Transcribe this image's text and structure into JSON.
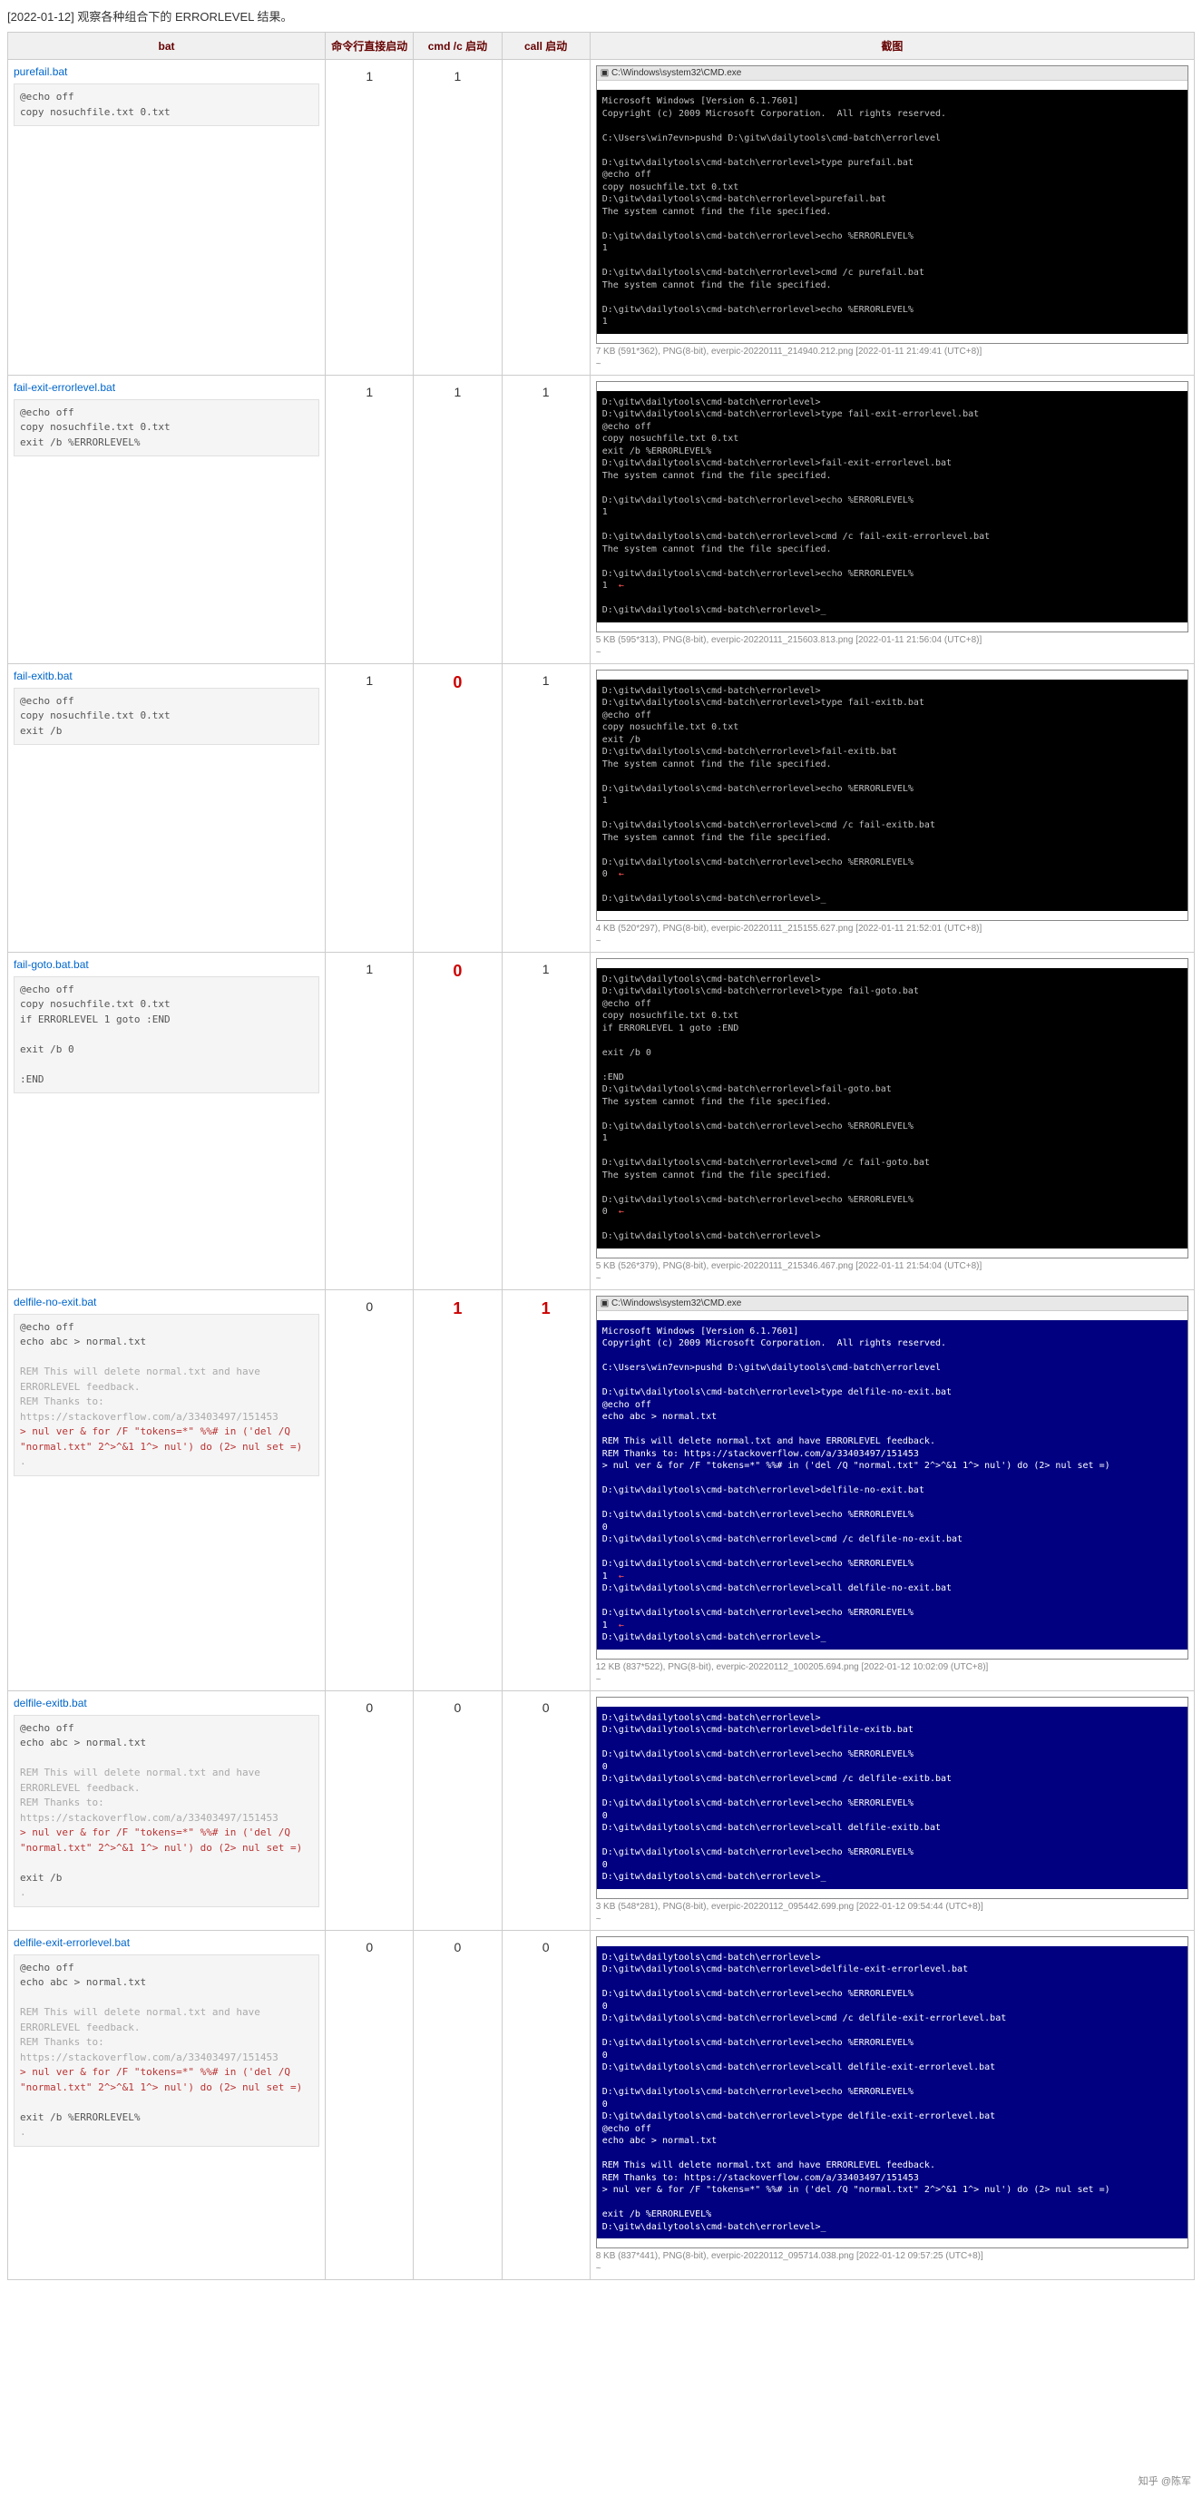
{
  "title": "[2022-01-12] 观察各种组合下的 ERRORLEVEL 结果。",
  "headers": {
    "bat": "bat",
    "direct": "命令行直接启动",
    "cmdc": "cmd /c 启动",
    "call": "call 启动",
    "shot": "截图"
  },
  "rows": [
    {
      "name": "purefail.bat",
      "code": "@echo off\ncopy nosuchfile.txt 0.txt",
      "direct": "1",
      "cmdc": "1",
      "call": "",
      "title": "C:\\Windows\\system32\\CMD.exe",
      "theme": "black",
      "shot": "Microsoft Windows [Version 6.1.7601]\nCopyright (c) 2009 Microsoft Corporation.  All rights reserved.\n\nC:\\Users\\win7evn>pushd D:\\gitw\\dailytools\\cmd-batch\\errorlevel\n\nD:\\gitw\\dailytools\\cmd-batch\\errorlevel>type purefail.bat\n@echo off\ncopy nosuchfile.txt 0.txt\nD:\\gitw\\dailytools\\cmd-batch\\errorlevel>purefail.bat\nThe system cannot find the file specified.\n\nD:\\gitw\\dailytools\\cmd-batch\\errorlevel>echo %ERRORLEVEL%\n1\n\nD:\\gitw\\dailytools\\cmd-batch\\errorlevel>cmd /c purefail.bat\nThe system cannot find the file specified.\n\nD:\\gitw\\dailytools\\cmd-batch\\errorlevel>echo %ERRORLEVEL%\n1",
      "cap": "7 KB (591*362), PNG(8-bit), everpic-20220111_214940.212.png [2022-01-11 21:49:41 (UTC+8)]"
    },
    {
      "name": "fail-exit-errorlevel.bat",
      "code": "@echo off\ncopy nosuchfile.txt 0.txt\nexit /b %ERRORLEVEL%",
      "direct": "1",
      "cmdc": "1",
      "call": "1",
      "theme": "black",
      "shot": "D:\\gitw\\dailytools\\cmd-batch\\errorlevel>\nD:\\gitw\\dailytools\\cmd-batch\\errorlevel>type fail-exit-errorlevel.bat\n@echo off\ncopy nosuchfile.txt 0.txt\nexit /b %ERRORLEVEL%\nD:\\gitw\\dailytools\\cmd-batch\\errorlevel>fail-exit-errorlevel.bat\nThe system cannot find the file specified.\n\nD:\\gitw\\dailytools\\cmd-batch\\errorlevel>echo %ERRORLEVEL%\n1\n\nD:\\gitw\\dailytools\\cmd-batch\\errorlevel>cmd /c fail-exit-errorlevel.bat\nThe system cannot find the file specified.\n\nD:\\gitw\\dailytools\\cmd-batch\\errorlevel>echo %ERRORLEVEL%\n1  ←\n\nD:\\gitw\\dailytools\\cmd-batch\\errorlevel>_",
      "cap": "5 KB (595*313), PNG(8-bit), everpic-20220111_215603.813.png [2022-01-11 21:56:04 (UTC+8)]"
    },
    {
      "name": "fail-exitb.bat",
      "code": "@echo off\ncopy nosuchfile.txt 0.txt\nexit /b",
      "direct": "1",
      "cmdc": "0",
      "call": "1",
      "cmdc_red": true,
      "theme": "black",
      "shot": "D:\\gitw\\dailytools\\cmd-batch\\errorlevel>\nD:\\gitw\\dailytools\\cmd-batch\\errorlevel>type fail-exitb.bat\n@echo off\ncopy nosuchfile.txt 0.txt\nexit /b\nD:\\gitw\\dailytools\\cmd-batch\\errorlevel>fail-exitb.bat\nThe system cannot find the file specified.\n\nD:\\gitw\\dailytools\\cmd-batch\\errorlevel>echo %ERRORLEVEL%\n1\n\nD:\\gitw\\dailytools\\cmd-batch\\errorlevel>cmd /c fail-exitb.bat\nThe system cannot find the file specified.\n\nD:\\gitw\\dailytools\\cmd-batch\\errorlevel>echo %ERRORLEVEL%\n0  ←\n\nD:\\gitw\\dailytools\\cmd-batch\\errorlevel>_",
      "cap": "4 KB (520*297), PNG(8-bit), everpic-20220111_215155.627.png [2022-01-11 21:52:01 (UTC+8)]"
    },
    {
      "name": "fail-goto.bat.bat",
      "code": "@echo off\ncopy nosuchfile.txt 0.txt\nif ERRORLEVEL 1 goto :END\n\nexit /b 0\n\n:END",
      "direct": "1",
      "cmdc": "0",
      "call": "1",
      "cmdc_red": true,
      "theme": "black",
      "shot": "D:\\gitw\\dailytools\\cmd-batch\\errorlevel>\nD:\\gitw\\dailytools\\cmd-batch\\errorlevel>type fail-goto.bat\n@echo off\ncopy nosuchfile.txt 0.txt\nif ERRORLEVEL 1 goto :END\n\nexit /b 0\n\n:END\nD:\\gitw\\dailytools\\cmd-batch\\errorlevel>fail-goto.bat\nThe system cannot find the file specified.\n\nD:\\gitw\\dailytools\\cmd-batch\\errorlevel>echo %ERRORLEVEL%\n1\n\nD:\\gitw\\dailytools\\cmd-batch\\errorlevel>cmd /c fail-goto.bat\nThe system cannot find the file specified.\n\nD:\\gitw\\dailytools\\cmd-batch\\errorlevel>echo %ERRORLEVEL%\n0  ←\n\nD:\\gitw\\dailytools\\cmd-batch\\errorlevel>",
      "cap": "5 KB (526*379), PNG(8-bit), everpic-20220111_215346.467.png [2022-01-11 21:54:04 (UTC+8)]"
    },
    {
      "name": "delfile-no-exit.bat",
      "code": "@echo off\necho abc > normal.txt\n\nREM This will delete normal.txt and have ERRORLEVEL feedback.\nREM Thanks to: https://stackoverflow.com/a/33403497/151453\n> nul ver & for /F \"tokens=*\" %%# in ('del /Q \"normal.txt\" 2^>^&1 1^> nul') do (2> nul set =)\n.",
      "direct": "0",
      "cmdc": "1",
      "call": "1",
      "cmdc_red": true,
      "call_red": true,
      "title": "C:\\Windows\\system32\\CMD.exe",
      "theme": "blue",
      "shot": "Microsoft Windows [Version 6.1.7601]\nCopyright (c) 2009 Microsoft Corporation.  All rights reserved.\n\nC:\\Users\\win7evn>pushd D:\\gitw\\dailytools\\cmd-batch\\errorlevel\n\nD:\\gitw\\dailytools\\cmd-batch\\errorlevel>type delfile-no-exit.bat\n@echo off\necho abc > normal.txt\n\nREM This will delete normal.txt and have ERRORLEVEL feedback.\nREM Thanks to: https://stackoverflow.com/a/33403497/151453\n> nul ver & for /F \"tokens=*\" %%# in ('del /Q \"normal.txt\" 2^>^&1 1^> nul') do (2> nul set =)\n\nD:\\gitw\\dailytools\\cmd-batch\\errorlevel>delfile-no-exit.bat\n\nD:\\gitw\\dailytools\\cmd-batch\\errorlevel>echo %ERRORLEVEL%\n0\nD:\\gitw\\dailytools\\cmd-batch\\errorlevel>cmd /c delfile-no-exit.bat\n\nD:\\gitw\\dailytools\\cmd-batch\\errorlevel>echo %ERRORLEVEL%\n1  ←\nD:\\gitw\\dailytools\\cmd-batch\\errorlevel>call delfile-no-exit.bat\n\nD:\\gitw\\dailytools\\cmd-batch\\errorlevel>echo %ERRORLEVEL%\n1  ←\nD:\\gitw\\dailytools\\cmd-batch\\errorlevel>_",
      "cap": "12 KB (837*522), PNG(8-bit), everpic-20220112_100205.694.png [2022-01-12 10:02:09 (UTC+8)]"
    },
    {
      "name": "delfile-exitb.bat",
      "code": "@echo off\necho abc > normal.txt\n\nREM This will delete normal.txt and have ERRORLEVEL feedback.\nREM Thanks to: https://stackoverflow.com/a/33403497/151453\n> nul ver & for /F \"tokens=*\" %%# in ('del /Q \"normal.txt\" 2^>^&1 1^> nul') do (2> nul set =)\n\nexit /b\n.",
      "direct": "0",
      "cmdc": "0",
      "call": "0",
      "theme": "blue",
      "shot": "D:\\gitw\\dailytools\\cmd-batch\\errorlevel>\nD:\\gitw\\dailytools\\cmd-batch\\errorlevel>delfile-exitb.bat\n\nD:\\gitw\\dailytools\\cmd-batch\\errorlevel>echo %ERRORLEVEL%\n0\nD:\\gitw\\dailytools\\cmd-batch\\errorlevel>cmd /c delfile-exitb.bat\n\nD:\\gitw\\dailytools\\cmd-batch\\errorlevel>echo %ERRORLEVEL%\n0\nD:\\gitw\\dailytools\\cmd-batch\\errorlevel>call delfile-exitb.bat\n\nD:\\gitw\\dailytools\\cmd-batch\\errorlevel>echo %ERRORLEVEL%\n0\nD:\\gitw\\dailytools\\cmd-batch\\errorlevel>_",
      "cap": "3 KB (548*281), PNG(8-bit), everpic-20220112_095442.699.png [2022-01-12 09:54:44 (UTC+8)]"
    },
    {
      "name": "delfile-exit-errorlevel.bat",
      "code": "@echo off\necho abc > normal.txt\n\nREM This will delete normal.txt and have ERRORLEVEL feedback.\nREM Thanks to: https://stackoverflow.com/a/33403497/151453\n> nul ver & for /F \"tokens=*\" %%# in ('del /Q \"normal.txt\" 2^>^&1 1^> nul') do (2> nul set =)\n\nexit /b %ERRORLEVEL%\n.",
      "direct": "0",
      "cmdc": "0",
      "call": "0",
      "theme": "blue",
      "shot": "D:\\gitw\\dailytools\\cmd-batch\\errorlevel>\nD:\\gitw\\dailytools\\cmd-batch\\errorlevel>delfile-exit-errorlevel.bat\n\nD:\\gitw\\dailytools\\cmd-batch\\errorlevel>echo %ERRORLEVEL%\n0\nD:\\gitw\\dailytools\\cmd-batch\\errorlevel>cmd /c delfile-exit-errorlevel.bat\n\nD:\\gitw\\dailytools\\cmd-batch\\errorlevel>echo %ERRORLEVEL%\n0\nD:\\gitw\\dailytools\\cmd-batch\\errorlevel>call delfile-exit-errorlevel.bat\n\nD:\\gitw\\dailytools\\cmd-batch\\errorlevel>echo %ERRORLEVEL%\n0\nD:\\gitw\\dailytools\\cmd-batch\\errorlevel>type delfile-exit-errorlevel.bat\n@echo off\necho abc > normal.txt\n\nREM This will delete normal.txt and have ERRORLEVEL feedback.\nREM Thanks to: https://stackoverflow.com/a/33403497/151453\n> nul ver & for /F \"tokens=*\" %%# in ('del /Q \"normal.txt\" 2^>^&1 1^> nul') do (2> nul set =)\n\nexit /b %ERRORLEVEL%\nD:\\gitw\\dailytools\\cmd-batch\\errorlevel>_",
      "cap": "8 KB (837*441), PNG(8-bit), everpic-20220112_095714.038.png [2022-01-12 09:57:25 (UTC+8)]"
    }
  ],
  "watermark": "知乎 @陈军"
}
